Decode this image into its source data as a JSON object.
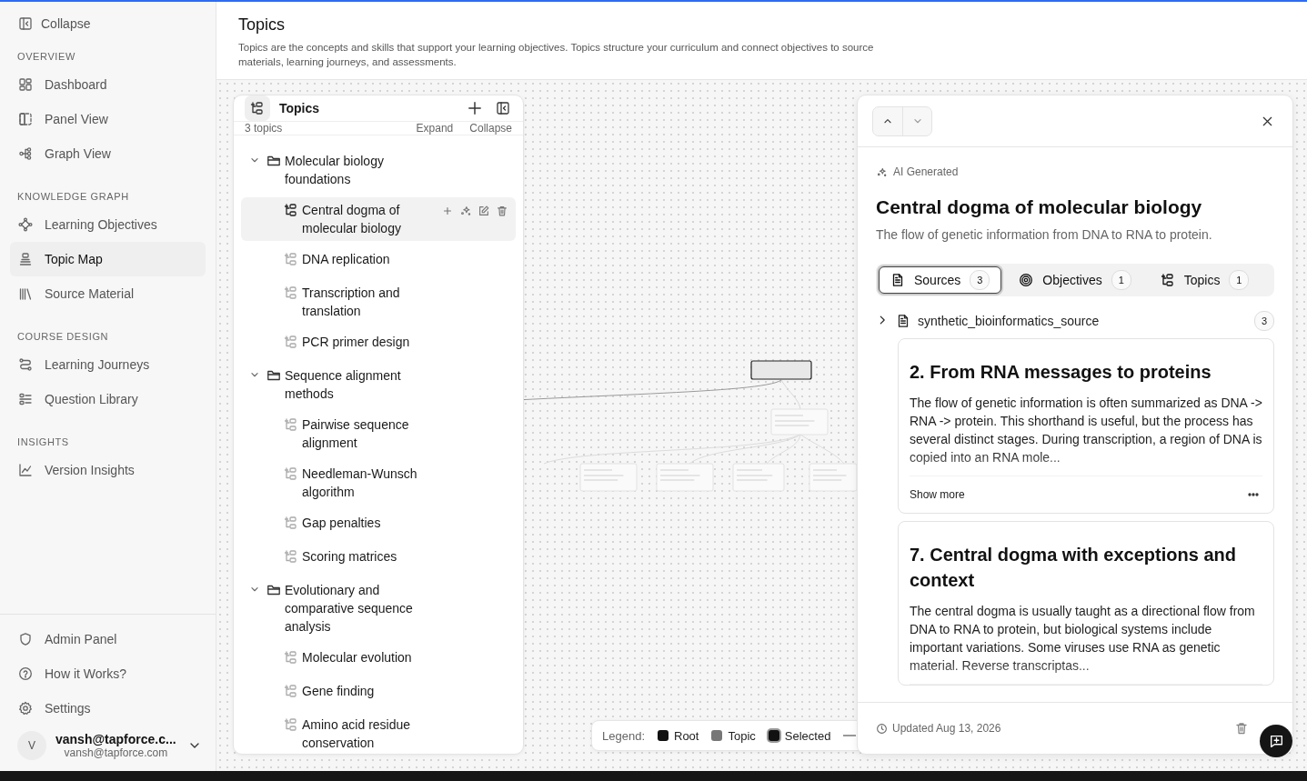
{
  "sidebar": {
    "collapse": "Collapse",
    "sections": [
      {
        "heading": "OVERVIEW",
        "items": [
          {
            "label": "Dashboard",
            "kind": "grid",
            "selected": false
          },
          {
            "label": "Panel View",
            "kind": "panel",
            "selected": false
          },
          {
            "label": "Graph View",
            "kind": "nodes",
            "selected": false
          }
        ]
      },
      {
        "heading": "KNOWLEDGE GRAPH",
        "items": [
          {
            "label": "Learning Objectives",
            "kind": "diamond",
            "selected": false
          },
          {
            "label": "Topic Map",
            "kind": "stack",
            "selected": true
          },
          {
            "label": "Source Material",
            "kind": "books",
            "selected": false
          }
        ]
      },
      {
        "heading": "COURSE DESIGN",
        "items": [
          {
            "label": "Learning Journeys",
            "kind": "route",
            "selected": false
          },
          {
            "label": "Question Library",
            "kind": "list",
            "selected": false
          }
        ]
      },
      {
        "heading": "INSIGHTS",
        "items": [
          {
            "label": "Version Insights",
            "kind": "chart",
            "selected": false
          }
        ]
      }
    ],
    "footer_items": [
      {
        "label": "Admin Panel",
        "kind": "shield"
      },
      {
        "label": "How it Works?",
        "kind": "help"
      },
      {
        "label": "Settings",
        "kind": "gear"
      }
    ],
    "user": {
      "avatar": "V",
      "name": "vansh@tapforce.c...",
      "email": "vansh@tapforce.com"
    }
  },
  "header": {
    "title": "Topics",
    "description": "Topics are the concepts and skills that support your learning objectives. Topics structure your curriculum and connect objectives to source materials, learning journeys, and assessments."
  },
  "topics_panel": {
    "title": "Topics",
    "count": "3 topics",
    "expand": "Expand",
    "collapse": "Collapse",
    "tree": [
      {
        "label": "Molecular biology foundations",
        "expanded": true,
        "children": [
          {
            "label": "Central dogma of molecular biology",
            "selected": true
          },
          {
            "label": "DNA replication",
            "selected": false
          },
          {
            "label": "Transcription and translation",
            "selected": false
          },
          {
            "label": "PCR primer design",
            "selected": false
          }
        ]
      },
      {
        "label": "Sequence alignment methods",
        "expanded": true,
        "children": [
          {
            "label": "Pairwise sequence alignment",
            "selected": false
          },
          {
            "label": "Needleman-Wunsch algorithm",
            "selected": false
          },
          {
            "label": "Gap penalties",
            "selected": false
          },
          {
            "label": "Scoring matrices",
            "selected": false
          }
        ]
      },
      {
        "label": "Evolutionary and comparative sequence analysis",
        "expanded": true,
        "children": [
          {
            "label": "Molecular evolution",
            "selected": false
          },
          {
            "label": "Gene finding",
            "selected": false
          },
          {
            "label": "Amino acid residue conservation",
            "selected": false
          }
        ]
      }
    ]
  },
  "legend": {
    "label": "Legend:",
    "items": [
      {
        "label": "Root",
        "kind": "root",
        "color": "#111111"
      },
      {
        "label": "Topic",
        "kind": "topic",
        "color": "#777777"
      },
      {
        "label": "Selected",
        "kind": "selected",
        "color": "#111111"
      }
    ]
  },
  "detail": {
    "badge": "AI Generated",
    "title": "Central dogma of molecular biology",
    "description": "The flow of genetic information from DNA to RNA to protein.",
    "tabs": [
      {
        "label": "Sources",
        "count": "3",
        "kind": "doc",
        "selected": true
      },
      {
        "label": "Objectives",
        "count": "1",
        "kind": "target",
        "selected": false
      },
      {
        "label": "Topics",
        "count": "1",
        "kind": "tree",
        "selected": false
      }
    ],
    "source": {
      "name": "synthetic_bioinformatics_source",
      "count": "3",
      "expanded": false
    },
    "excerpts": [
      {
        "title": "2. From RNA messages to proteins",
        "text": "The flow of genetic information is often summarized as DNA -> RNA -> protein. This shorthand is useful, but the process has several distinct stages. During transcription, a region of DNA is copied into an RNA mole...",
        "show_more": "Show more"
      },
      {
        "title": "7. Central dogma with exceptions and context",
        "text": "The central dogma is usually taught as a directional flow from DNA to RNA to protein, but biological systems include important variations. Some viruses use RNA as genetic material. Reverse transcriptas..."
      }
    ],
    "updated": "Updated Aug 13, 2026"
  }
}
